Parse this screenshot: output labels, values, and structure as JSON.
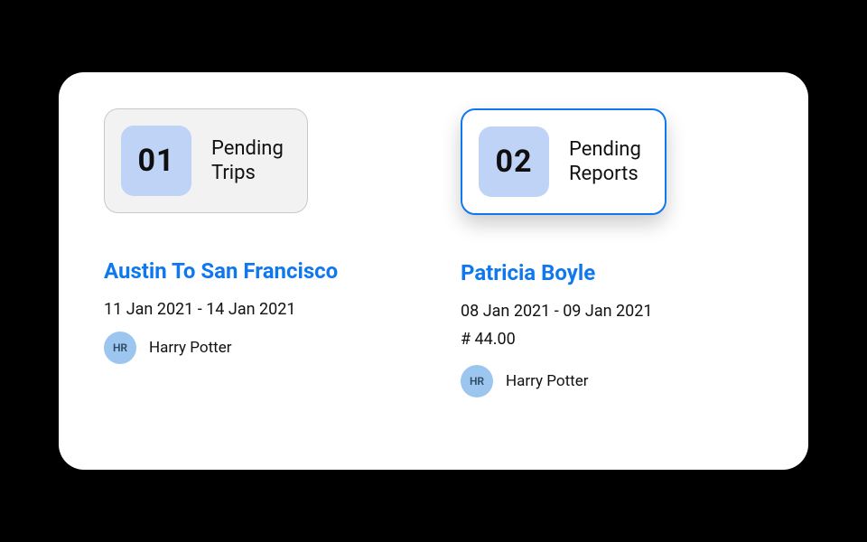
{
  "cards": [
    {
      "count": "01",
      "label": "Pending\nTrips",
      "title": "Austin To San Francisco",
      "date_range": "11 Jan 2021 - 14 Jan 2021",
      "amount": null,
      "avatar_initials": "HR",
      "person": "Harry Potter"
    },
    {
      "count": "02",
      "label": "Pending\nReports",
      "title": "Patricia Boyle",
      "date_range": "08 Jan 2021 - 09 Jan 2021",
      "amount": "# 44.00",
      "avatar_initials": "HR",
      "person": "Harry Potter"
    }
  ]
}
